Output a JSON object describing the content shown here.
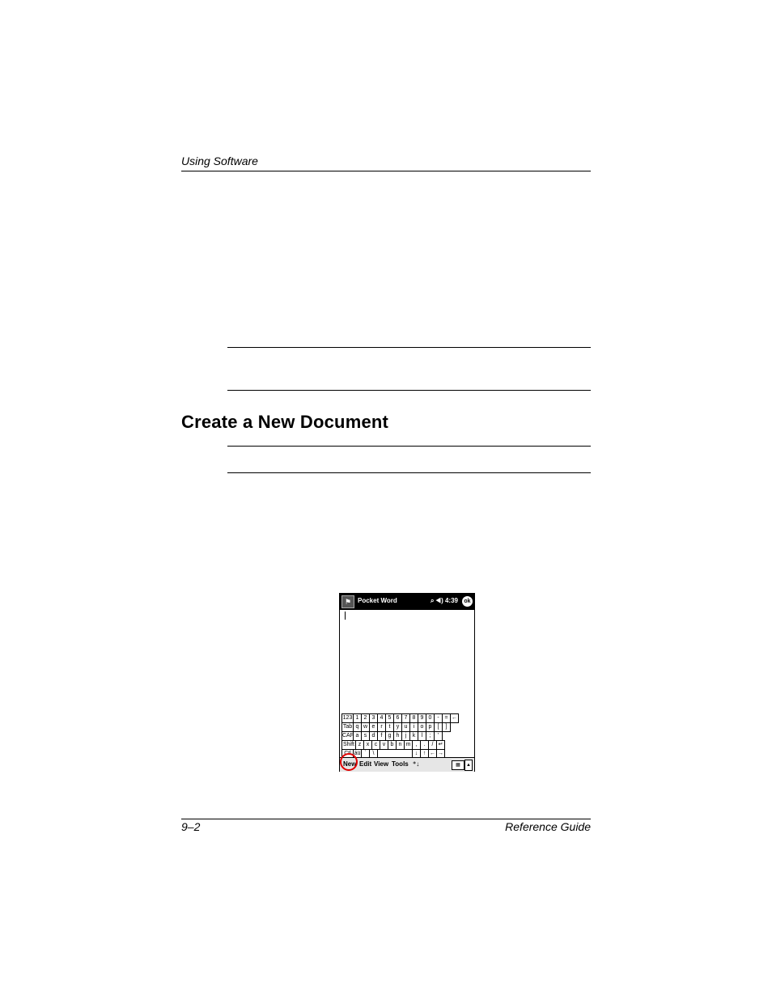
{
  "header": {
    "section_title": "Using Software"
  },
  "heading": {
    "title": "Create a New Document"
  },
  "footer": {
    "page_number": "9–2",
    "guide_name": "Reference Guide"
  },
  "screenshot": {
    "app_title": "Pocket Word",
    "clock": "4:39",
    "ok_label": "ok",
    "keyboard_rows": [
      [
        "123",
        "1",
        "2",
        "3",
        "4",
        "5",
        "6",
        "7",
        "8",
        "9",
        "0",
        "-",
        "=",
        "←"
      ],
      [
        "Tab",
        "q",
        "w",
        "e",
        "r",
        "t",
        "y",
        "u",
        "i",
        "o",
        "p",
        "[",
        "]"
      ],
      [
        "CAP",
        "a",
        "s",
        "d",
        "f",
        "g",
        "h",
        "j",
        "k",
        "l",
        ";",
        "'"
      ],
      [
        "Shift",
        "z",
        "x",
        "c",
        "v",
        "b",
        "n",
        "m",
        ",",
        ".",
        "/",
        "↵"
      ],
      [
        "Ctl",
        "áü",
        "`",
        "\\",
        "",
        "↓",
        "↑",
        "←",
        "→"
      ]
    ],
    "menu": {
      "new": "New",
      "edit": "Edit",
      "view": "View",
      "tools": "Tools"
    }
  }
}
